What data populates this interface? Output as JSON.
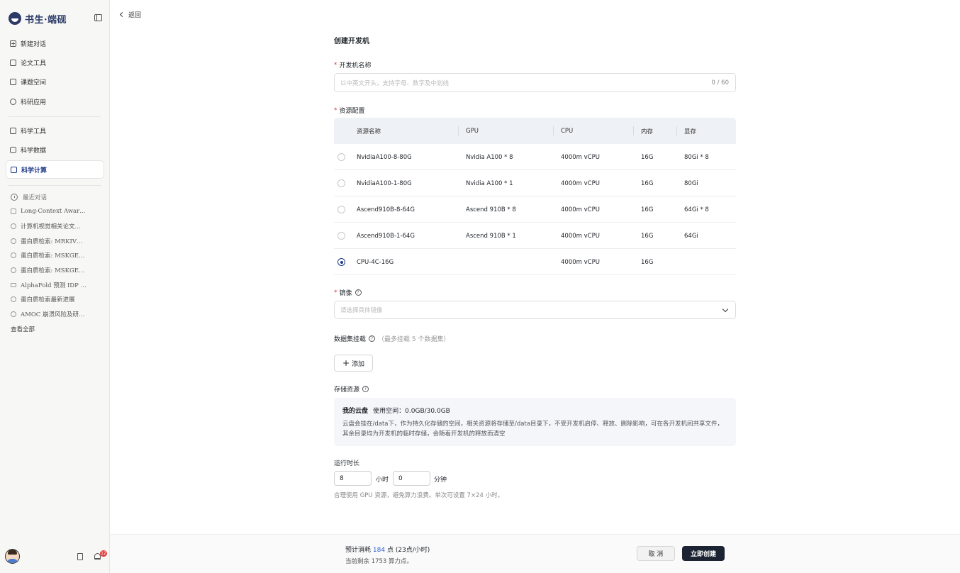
{
  "brand": {
    "name": "书生·端砚"
  },
  "sidebar": {
    "nav": [
      {
        "label": "新建对话",
        "icon": "new-chat-icon"
      },
      {
        "label": "论文工具",
        "icon": "paper-icon"
      },
      {
        "label": "课题空间",
        "icon": "book-icon"
      },
      {
        "label": "科研应用",
        "icon": "cube-icon"
      }
    ],
    "nav2": [
      {
        "label": "科学工具",
        "icon": "toolbox-icon"
      },
      {
        "label": "科学数据",
        "icon": "database-icon"
      },
      {
        "label": "科学计算",
        "icon": "monitor-icon",
        "active": true
      }
    ],
    "recent_title": "最近对话",
    "recent": [
      "Long-Context Awar…",
      "计算机视觉相关论文…",
      "蛋白质检索: MRKIV…",
      "蛋白质检索: MSKGE…",
      "蛋白质检索: MSKGE…",
      "AlphaFold 预测 IDP …",
      "蛋白质检索最新进展",
      "AMOC 崩溃风险及研…"
    ],
    "see_all": "查看全部",
    "notification_count": "12"
  },
  "header": {
    "back_label": "返回"
  },
  "form": {
    "title": "创建开发机",
    "name_label": "开发机名称",
    "name_placeholder": "以中英文开头，支持字母、数字及中划线",
    "name_counter": "0 / 60",
    "resource_label": "资源配置",
    "columns": [
      "资源名称",
      "GPU",
      "CPU",
      "内存",
      "显存"
    ],
    "resources": [
      {
        "name": "NvidiaA100-8-80G",
        "gpu": "Nvidia A100 * 8",
        "cpu": "4000m vCPU",
        "mem": "16G",
        "vram": "80Gi * 8",
        "selected": false
      },
      {
        "name": "NvidiaA100-1-80G",
        "gpu": "Nvidia A100 * 1",
        "cpu": "4000m vCPU",
        "mem": "16G",
        "vram": "80Gi",
        "selected": false
      },
      {
        "name": "Ascend910B-8-64G",
        "gpu": "Ascend 910B * 8",
        "cpu": "4000m vCPU",
        "mem": "16G",
        "vram": "64Gi * 8",
        "selected": false
      },
      {
        "name": "Ascend910B-1-64G",
        "gpu": "Ascend 910B * 1",
        "cpu": "4000m vCPU",
        "mem": "16G",
        "vram": "64Gi",
        "selected": false
      },
      {
        "name": "CPU-4C-16G",
        "gpu": "",
        "cpu": "4000m vCPU",
        "mem": "16G",
        "vram": "",
        "selected": true
      }
    ],
    "image_label": "镜像",
    "image_placeholder": "请选择具体镜像",
    "dataset_label": "数据集挂载",
    "dataset_hint": "（最多挂载 5 个数据集）",
    "add_label": "添加",
    "storage_label": "存储资源",
    "storage_title": "我的云盘",
    "storage_usage": "使用空间：0.0GB/30.0GB",
    "storage_desc": "云盘会挂在/data下，作为持久化存储的空间，相关资源将存储至/data目录下，不受开发机启停、释放、删除影响，可在各开发机间共享文件，其余目录均为开发机的临时存储，会随着开发机的释放而清空",
    "runtime_label": "运行时长",
    "hours_value": "8",
    "hours_unit": "小时",
    "minutes_value": "0",
    "minutes_unit": "分钟",
    "runtime_hint": "合理使用 GPU 资源，避免算力浪费。单次可设置 7×24 小时。"
  },
  "footer": {
    "cost_prefix": "预计消耗",
    "cost_value": "184",
    "cost_suffix": "点 (23点/小时)",
    "remaining": "当前剩余 1753 算力点。",
    "cancel_label": "取 消",
    "create_label": "立即创建"
  },
  "colors": {
    "accent": "#1f3a8a",
    "primary_button": "#1c2434",
    "required": "#e23b3b",
    "cost": "#2f5fd0"
  }
}
